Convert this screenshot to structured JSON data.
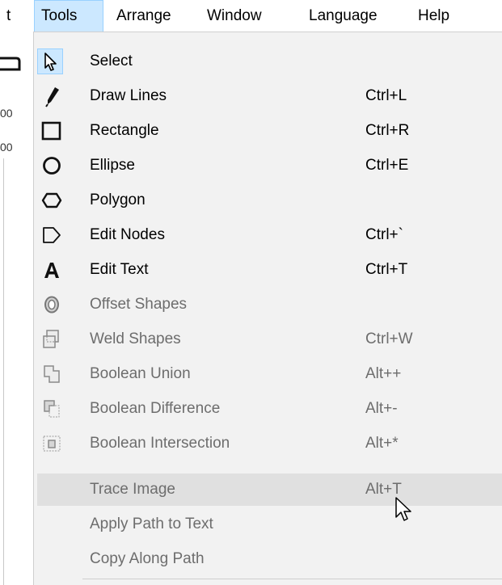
{
  "menubar": {
    "items": [
      {
        "label": "t"
      },
      {
        "label": "Tools"
      },
      {
        "label": "Arrange"
      },
      {
        "label": "Window"
      },
      {
        "label": "Language"
      },
      {
        "label": "Help"
      }
    ]
  },
  "left_strip": {
    "ruler": [
      "00",
      "00"
    ]
  },
  "menu": {
    "items": [
      {
        "label": "Select",
        "shortcut": "",
        "icon": "pointer-icon",
        "enabled": true
      },
      {
        "label": "Draw Lines",
        "shortcut": "Ctrl+L",
        "icon": "pen-icon",
        "enabled": true
      },
      {
        "label": "Rectangle",
        "shortcut": "Ctrl+R",
        "icon": "rectangle-icon",
        "enabled": true
      },
      {
        "label": "Ellipse",
        "shortcut": "Ctrl+E",
        "icon": "ellipse-icon",
        "enabled": true
      },
      {
        "label": "Polygon",
        "shortcut": "",
        "icon": "hexagon-icon",
        "enabled": true
      },
      {
        "label": "Edit Nodes",
        "shortcut": "Ctrl+`",
        "icon": "pentagon-icon",
        "enabled": true
      },
      {
        "label": "Edit Text",
        "shortcut": "Ctrl+T",
        "icon": "text-a-icon",
        "enabled": true
      },
      {
        "label": "Offset Shapes",
        "shortcut": "",
        "icon": "offset-shapes-icon",
        "enabled": false
      },
      {
        "label": "Weld Shapes",
        "shortcut": "Ctrl+W",
        "icon": "weld-shapes-icon",
        "enabled": false
      },
      {
        "label": "Boolean Union",
        "shortcut": "Alt++",
        "icon": "boolean-union-icon",
        "enabled": false
      },
      {
        "label": "Boolean Difference",
        "shortcut": "Alt+-",
        "icon": "boolean-difference-icon",
        "enabled": false
      },
      {
        "label": "Boolean Intersection",
        "shortcut": "Alt+*",
        "icon": "boolean-intersection-icon",
        "enabled": false
      },
      {
        "label": "Trace Image",
        "shortcut": "Alt+T",
        "icon": "",
        "enabled": false
      },
      {
        "label": "Apply Path to Text",
        "shortcut": "",
        "icon": "",
        "enabled": false
      },
      {
        "label": "Copy Along Path",
        "shortcut": "",
        "icon": "",
        "enabled": false
      }
    ]
  },
  "colors": {
    "active_menu_bg": "#cce8ff",
    "active_menu_border": "#99d1ff",
    "menu_bg": "#f2f2f2",
    "hover_bg": "#e0e0e0",
    "disabled_text": "#6d6d6d"
  }
}
